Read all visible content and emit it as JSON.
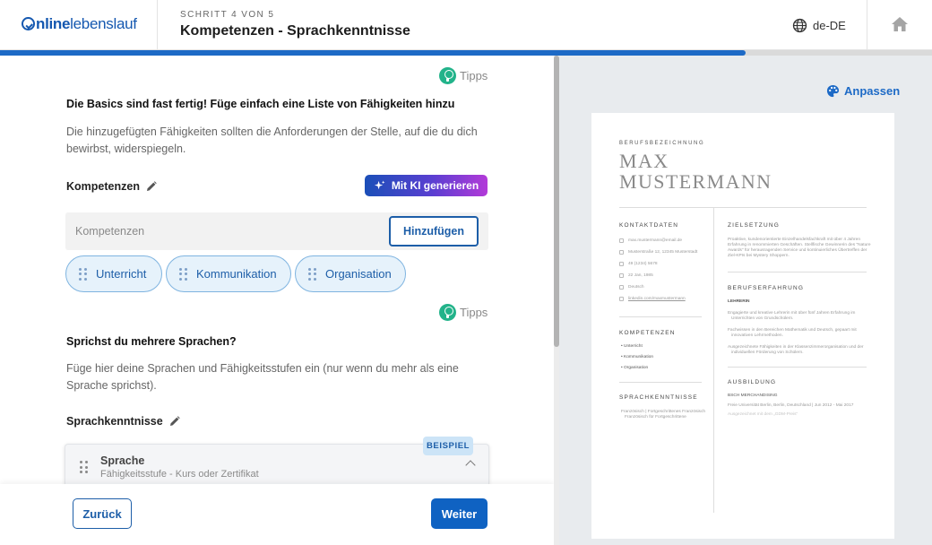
{
  "header": {
    "logo_bold": "nline",
    "logo_light": "lebenslauf",
    "step_label": "SCHRITT 4 VON 5",
    "page_title": "Kompetenzen - Sprachkenntnisse",
    "language": "de-DE",
    "progress_fraction": 0.8
  },
  "tips_label": "Tipps",
  "skills_section": {
    "heading": "Die Basics sind fast fertig! Füge einfach eine Liste von Fähigkeiten hinzu",
    "description": "Die hinzugefügten Fähigkeiten sollten die Anforderungen der Stelle, auf die du dich bewirbst, widerspiegeln.",
    "subheading": "Kompetenzen",
    "ai_button": "Mit KI generieren",
    "input_placeholder": "Kompetenzen",
    "add_button": "Hinzufügen",
    "chips": [
      "Unterricht",
      "Kommunikation",
      "Organisation"
    ]
  },
  "languages_section": {
    "heading": "Sprichst du mehrere Sprachen?",
    "description": "Füge hier deine Sprachen und Fähigkeitsstufen ein (nur wenn du mehr als eine Sprache sprichst).",
    "subheading": "Sprachkenntnisse",
    "badge": "BEISPIEL",
    "card_title": "Sprache",
    "card_subtitle": "Fähigkeitsstufe - Kurs oder Zertifikat"
  },
  "footer": {
    "back": "Zurück",
    "next": "Weiter"
  },
  "preview": {
    "customize": "Anpassen",
    "role": "BERUFSBEZEICHNUNG",
    "name_line1": "MAX",
    "name_line2": "MUSTERMANN",
    "contact_heading": "KONTAKTDATEN",
    "contact": [
      "max.mustermann@email.de",
      "Musterstraße 12, 12345 Musterstadt",
      "49 (1234) 5678",
      "22 Jan, 1985",
      "Deutsch",
      "linkedin.com/maxmustermann"
    ],
    "skills_heading": "KOMPETENZEN",
    "skills": [
      "Unterricht",
      "Kommunikation",
      "Organisation"
    ],
    "languages_heading": "SPRACHKENNTNISSE",
    "languages_line1": "Französisch | Fortgeschrittenes Französisch",
    "languages_line2": "Französisch für Fortgeschrittene",
    "objective_heading": "ZIELSETZUNG",
    "objective_l1": "Proaktive, kundenorientierte Einzelhandelsfachkraft mit über 4 Jahren",
    "objective_l2": "Erfahrung in renommierten Geschäften. Stellfische Gewinnerin des \"Nature",
    "objective_l3": "Awards\" für herausragenden Service und kontinuierliches Übertreffen der",
    "objective_l4": "Ziel-KPIs bei Mystery Shoppern.",
    "experience_heading": "BERUFSERFAHRUNG",
    "job_title": "LEHRERIN",
    "exp_b1a": "Engagierte und kreative Lehrerin mit über fünf Jahren Erfahrung im",
    "exp_b1b": "Unterrichten von Grundschülern.",
    "exp_b2a": "Fachwissen in den Bereichen Mathematik und Deutsch, gepaart mit",
    "exp_b2b": "innovativen Lehrmethoden.",
    "exp_b3a": "Ausgezeichnete Fähigkeiten in der Klassenzimmerorganisation und der",
    "exp_b3b": "individuellen Förderung von Schülern.",
    "education_heading": "AUSBILDUNG",
    "degree": "BSCH MERCHANDISING",
    "school": "Freie Universität Berlin, Berlin, Deutschland | Jun 2012 - Mai 2017",
    "edu_note": "Ausgezeichnet mit dem „GDM-Preis“"
  }
}
